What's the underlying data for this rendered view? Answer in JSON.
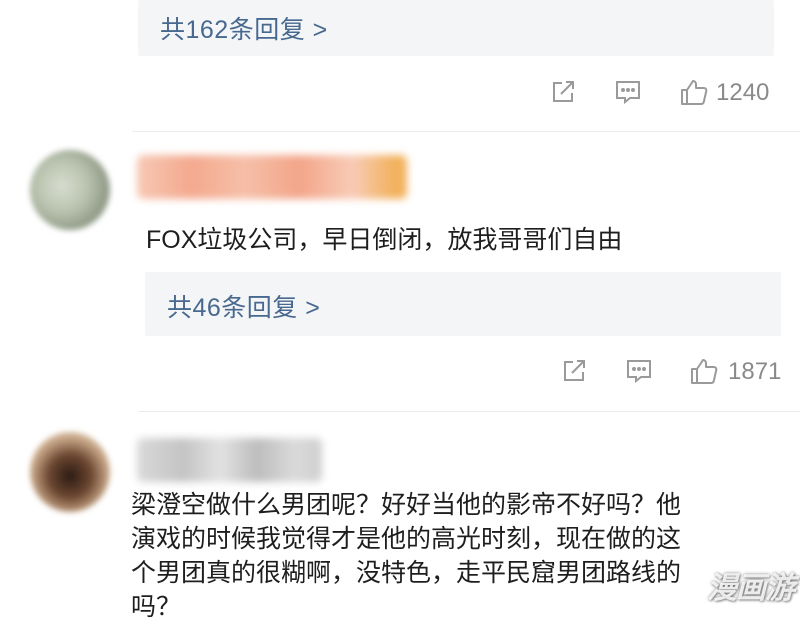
{
  "comments": [
    {
      "reply_summary": "共162条回复 >",
      "likes": "1240"
    },
    {
      "text": "FOX垃圾公司，早日倒闭，放我哥哥们自由",
      "reply_summary": "共46条回复 >",
      "likes": "1871"
    },
    {
      "text_lines": [
        "梁澄空做什么男团呢？好好当他的影帝不好吗？他",
        "演戏的时候我觉得才是他的高光时刻，现在做的这",
        "个男团真的很糊啊，没特色，走平民窟男团路线的",
        "吗？"
      ]
    }
  ],
  "icons": {
    "share": "share-icon",
    "comment": "comment-icon",
    "like": "thumbs-up-icon"
  },
  "colors": {
    "link": "#47698f",
    "reply_bg": "#f4f5f7",
    "meta_gray": "#8a8a8a"
  },
  "watermark": "漫画游"
}
